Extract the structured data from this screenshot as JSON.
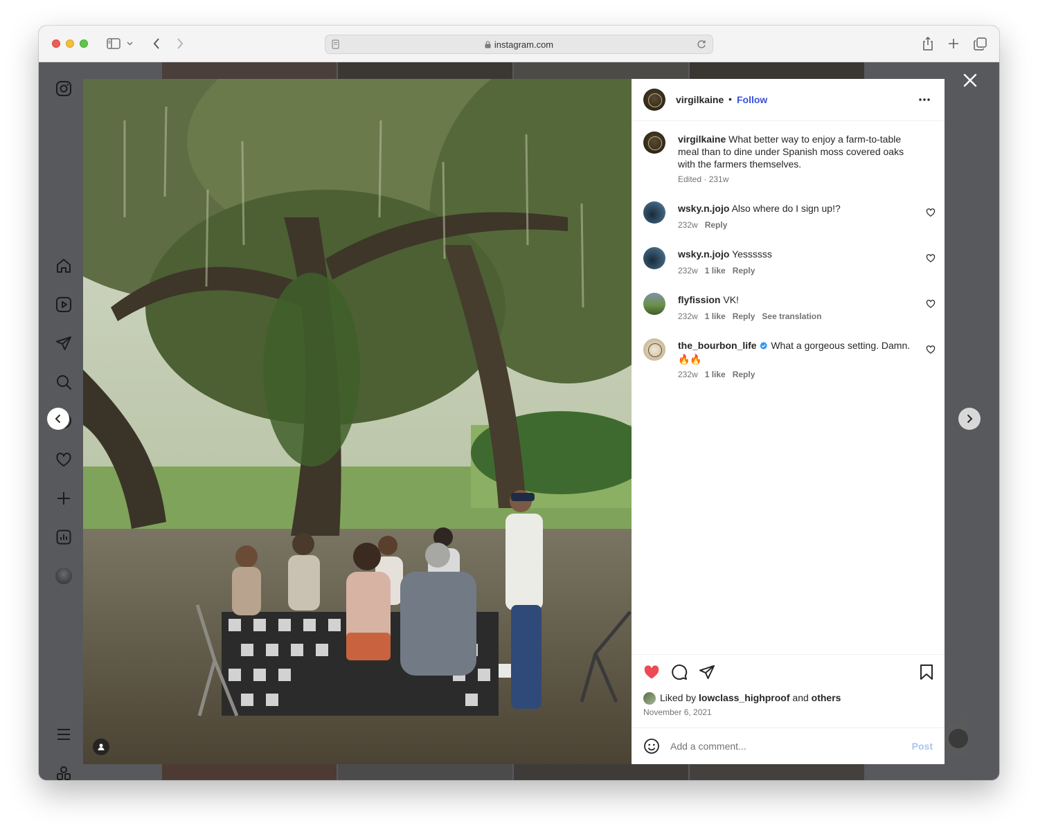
{
  "browser": {
    "url": "instagram.com"
  },
  "post": {
    "author": "virgilkaine",
    "follow_label": "Follow",
    "dot": "•",
    "caption": "What better way to enjoy a farm-to-table meal than to dine under Spanish moss covered oaks with the farmers themselves.",
    "caption_meta": "Edited · 231w",
    "comments": [
      {
        "user": "wsky.n.jojo",
        "text": "Also where do I sign up!?",
        "age": "232w",
        "likes": "",
        "reply": "Reply",
        "translation": ""
      },
      {
        "user": "wsky.n.jojo",
        "text": "Yessssss",
        "age": "232w",
        "likes": "1 like",
        "reply": "Reply",
        "translation": ""
      },
      {
        "user": "flyfission",
        "text": "VK!",
        "age": "232w",
        "likes": "1 like",
        "reply": "Reply",
        "translation": "See translation"
      },
      {
        "user": "the_bourbon_life",
        "text": "What a gorgeous setting. Damn.",
        "emoji": "🔥🔥",
        "age": "232w",
        "likes": "1 like",
        "reply": "Reply",
        "translation": ""
      }
    ],
    "liked_by_prefix": "Liked by",
    "liked_by_user": "lowclass_highproof",
    "liked_by_and": "and",
    "liked_by_others": "others",
    "date": "November 6, 2021",
    "comment_placeholder": "Add a comment...",
    "post_label": "Post"
  },
  "colors": {
    "like_heart": "#ed4956",
    "follow": "#3851d8",
    "verified": "#3897f0"
  },
  "icons": {
    "nav": [
      "instagram-icon",
      "home-icon",
      "reels-icon",
      "messages-icon",
      "search-icon",
      "explore-icon",
      "notifications-icon",
      "create-icon",
      "insights-icon",
      "profile-avatar",
      "more-menu-icon",
      "threads-icon"
    ]
  }
}
